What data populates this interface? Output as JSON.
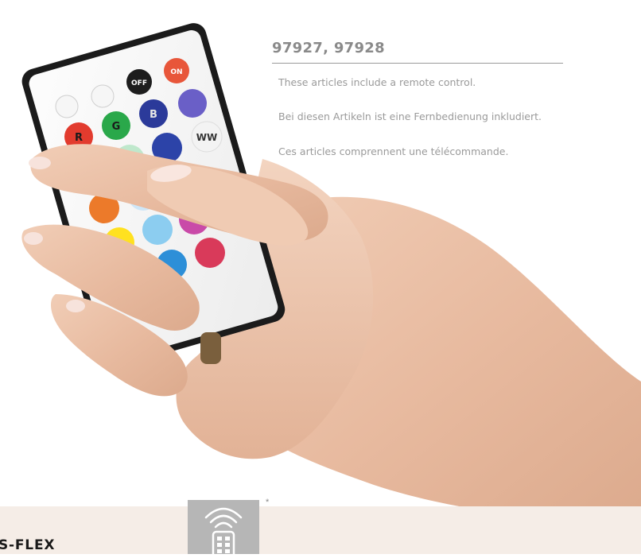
{
  "article": {
    "numbers": "97927, 97928",
    "text_en": "These articles include a remote control.",
    "text_de": "Bei diesen Artikeln ist eine Fernbedienung inkludiert.",
    "text_fr": "Ces articles comprennent une télécommande."
  },
  "remote": {
    "button_off": "OFF",
    "button_on": "ON",
    "button_r": "R",
    "button_g": "G",
    "button_b": "B",
    "button_ww": "WW"
  },
  "footer": {
    "label": "S-FLEX",
    "badge_asterisk": "*",
    "badge_icon": "remote-control-icon"
  },
  "colors": {
    "footer_band": "#f5ede7",
    "title_gray": "#8a8a8a",
    "badge_gray": "#b6b6b6"
  }
}
